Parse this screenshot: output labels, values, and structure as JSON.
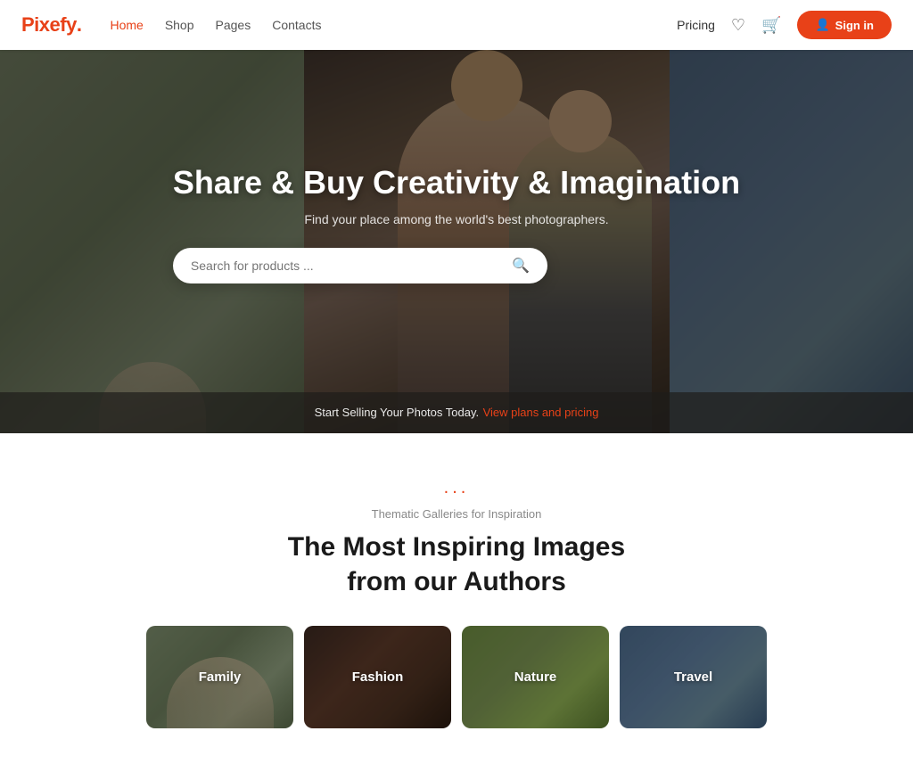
{
  "navbar": {
    "logo_text": "Pixefy",
    "logo_dot": ".",
    "nav_links": [
      {
        "label": "Home",
        "active": true
      },
      {
        "label": "Shop",
        "active": false
      },
      {
        "label": "Pages",
        "active": false
      },
      {
        "label": "Contacts",
        "active": false
      }
    ],
    "pricing_label": "Pricing",
    "signin_label": "Sign in"
  },
  "hero": {
    "title": "Share & Buy Creativity & Imagination",
    "subtitle": "Find your place among the world's best photographers.",
    "search_placeholder": "Search for products ...",
    "bottom_text": "Start Selling Your Photos Today.",
    "bottom_link": "View plans and pricing"
  },
  "gallery_section": {
    "dots": "...",
    "subtitle": "Thematic Galleries for Inspiration",
    "title_line1": "The Most Inspiring Images",
    "title_line2": "from our Authors",
    "cards": [
      {
        "label": "Family",
        "bg_class": "card-family"
      },
      {
        "label": "Fashion",
        "bg_class": "card-fashion"
      },
      {
        "label": "Nature",
        "bg_class": "card-nature"
      },
      {
        "label": "Travel",
        "bg_class": "card-travel"
      }
    ]
  }
}
